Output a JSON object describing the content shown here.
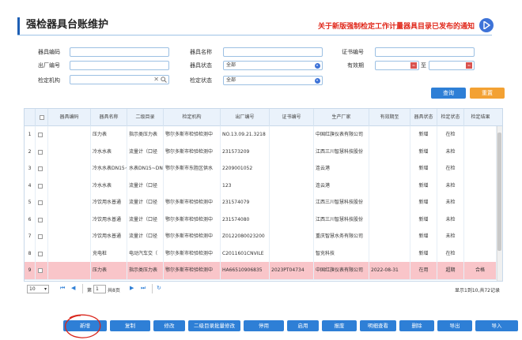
{
  "header": {
    "title": "强检器具台账维护",
    "notice": "关于新版强制检定工作计量器具目录已发布的通知"
  },
  "form": {
    "fields": [
      {
        "label": "器具编码",
        "value": ""
      },
      {
        "label": "器具名称",
        "value": ""
      },
      {
        "label": "证书编号",
        "value": ""
      },
      {
        "label": "出厂编号",
        "value": ""
      },
      {
        "label": "器具状态",
        "value": "全部"
      },
      {
        "label": "有效期",
        "value": ""
      },
      {
        "label": "检定机构",
        "value": ""
      },
      {
        "label": "检定状态",
        "value": "全部"
      }
    ],
    "date_to": "至",
    "clear_icon": "close-icon",
    "search_icon": "search-icon",
    "query_label": "查询",
    "reset_label": "重置"
  },
  "table": {
    "headers": [
      "器具编码",
      "器具名称",
      "二级目录",
      "检定机构",
      "出厂编号",
      "证书编号",
      "生产厂家",
      "有效期至",
      "器具状态",
      "检定状态",
      "检定结果"
    ],
    "rows": [
      {
        "no": "1",
        "cells": [
          "",
          "压力表",
          "指示类压力表",
          "鄂尔多斯市检验检测中",
          "NO.13.09.21.3218",
          "",
          "中国红旗仪表有限公司",
          "",
          "新增",
          "在检",
          ""
        ]
      },
      {
        "no": "2",
        "cells": [
          "",
          "冷水水表",
          "流量计（口径",
          "鄂尔多斯市检验检测中",
          "231573209",
          "",
          "江西三川智慧科技股份",
          "",
          "新增",
          "未检",
          ""
        ]
      },
      {
        "no": "3",
        "cells": [
          "",
          "冷水水表DN15~DN",
          "水表DN15~DN",
          "鄂尔多斯市东胜区供水",
          "2209001052",
          "",
          "连云港",
          "",
          "新增",
          "在检",
          ""
        ]
      },
      {
        "no": "4",
        "cells": [
          "",
          "冷水水表",
          "流量计（口径",
          "",
          "123",
          "",
          "连云港",
          "",
          "新增",
          "未检",
          ""
        ]
      },
      {
        "no": "5",
        "cells": [
          "",
          "冷饮用水普通",
          "流量计（口径",
          "鄂尔多斯市检验检测中",
          "231574079",
          "",
          "江西三川智慧科技股份",
          "",
          "新增",
          "未检",
          ""
        ]
      },
      {
        "no": "6",
        "cells": [
          "",
          "冷饮用水普通",
          "流量计（口径",
          "鄂尔多斯市检验检测中",
          "231574080",
          "",
          "江西三川智慧科技股份",
          "",
          "新增",
          "未检",
          ""
        ]
      },
      {
        "no": "7",
        "cells": [
          "",
          "冷饮用水普通",
          "流量计（口径",
          "鄂尔多斯市检验检测中",
          "Z0122080023200",
          "",
          "重庆智慧水务有限公司",
          "",
          "新增",
          "未检",
          ""
        ]
      },
      {
        "no": "8",
        "cells": [
          "",
          "充电桩",
          "电动汽车交（",
          "鄂尔多斯市检验检测中",
          "C2011601CNVILE",
          "",
          "智充科技",
          "",
          "新增",
          "在检",
          ""
        ]
      },
      {
        "no": "9",
        "cells": [
          "",
          "压力表",
          "指示类压力表",
          "鄂尔多斯市检验检测中",
          "HA66510906835",
          "2023PT04734",
          "中国红旗仪表有限公司",
          "2022-08-31",
          "在用",
          "超期",
          "合格"
        ]
      }
    ]
  },
  "pager": {
    "page_size": "10",
    "page_prefix": "第",
    "page_value": "1",
    "page_suffix": "共8页",
    "summary": "显示1到10,共72记录"
  },
  "actions": [
    "新增",
    "复制",
    "修改",
    "二级目录批量修改",
    "停用",
    "启用",
    "报废",
    "明细查看",
    "删除",
    "导出",
    "导入"
  ],
  "colors": {
    "accent": "#2e7fd6",
    "orange": "#f3a133",
    "notice": "#e0281b",
    "highlight_row": "#f9c5c9"
  }
}
